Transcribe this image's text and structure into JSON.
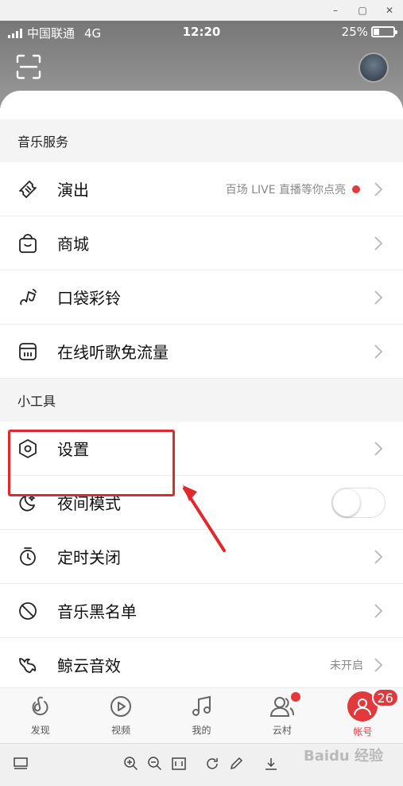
{
  "window": {
    "controls": [
      "–",
      "▢",
      "✕"
    ]
  },
  "status": {
    "carrier": "中国联通",
    "network": "4G",
    "time": "12:20",
    "battery": "25%",
    "battery_level": 0.25
  },
  "sections": {
    "music": {
      "title": "音乐服务",
      "items": [
        {
          "label": "演出",
          "hint": "百场 LIVE 直播等你点亮",
          "icon": "ticket-icon"
        },
        {
          "label": "商城",
          "icon": "shopping-bag-icon"
        },
        {
          "label": "口袋彩铃",
          "icon": "ringtone-icon"
        },
        {
          "label": "在线听歌免流量",
          "icon": "sim-card-icon"
        }
      ]
    },
    "tools": {
      "title": "小工具",
      "items": [
        {
          "label": "设置",
          "icon": "settings-hexagon-icon"
        },
        {
          "label": "夜间模式",
          "icon": "moon-icon",
          "toggle": false
        },
        {
          "label": "定时关闭",
          "icon": "timer-icon"
        },
        {
          "label": "音乐黑名单",
          "icon": "block-icon"
        },
        {
          "label": "鲸云音效",
          "hint": "未开启",
          "icon": "whale-icon"
        }
      ]
    }
  },
  "tabs": [
    {
      "label": "发现",
      "icon": "netease-logo-icon"
    },
    {
      "label": "视频",
      "icon": "video-play-icon"
    },
    {
      "label": "我的",
      "icon": "music-note-icon"
    },
    {
      "label": "云村",
      "icon": "friends-icon"
    },
    {
      "label": "帐号",
      "icon": "user-icon",
      "badge": "26"
    }
  ],
  "accent": "#e4393c",
  "highlight_color": "#e0292b",
  "watermark": "Baidu 经验"
}
